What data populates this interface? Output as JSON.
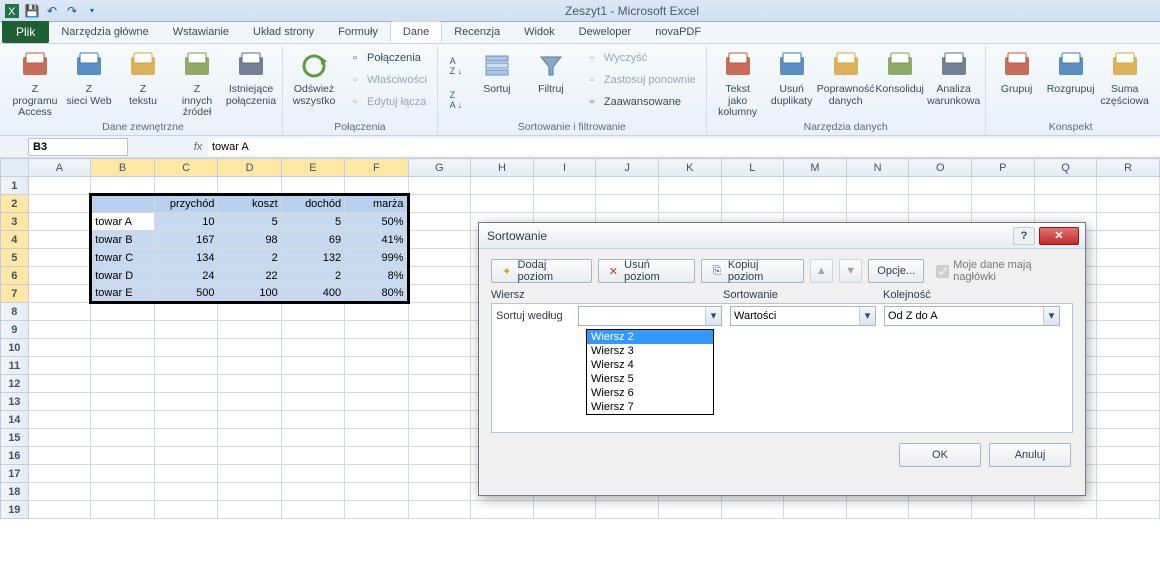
{
  "window_title": "Zeszyt1 - Microsoft Excel",
  "tabs": {
    "file": "Plik",
    "items": [
      "Narzędzia główne",
      "Wstawianie",
      "Układ strony",
      "Formuły",
      "Dane",
      "Recenzja",
      "Widok",
      "Deweloper",
      "novaPDF"
    ],
    "active": "Dane"
  },
  "ribbon": {
    "groups": {
      "external": {
        "label": "Dane zewnętrzne",
        "buttons": [
          "Z programu Access",
          "Z sieci Web",
          "Z tekstu",
          "Z innych źródeł",
          "Istniejące połączenia"
        ]
      },
      "connections": {
        "label": "Połączenia",
        "refresh": "Odśwież wszystko",
        "items": [
          "Połączenia",
          "Właściwości",
          "Edytuj łącza"
        ]
      },
      "sort": {
        "label": "Sortowanie i filtrowanie",
        "sort": "Sortuj",
        "filter": "Filtruj",
        "items": [
          "Wyczyść",
          "Zastosuj ponownie",
          "Zaawansowane"
        ]
      },
      "datatools": {
        "label": "Narzędzia danych",
        "buttons": [
          "Tekst jako kolumny",
          "Usuń duplikaty",
          "Poprawność danych",
          "Konsoliduj",
          "Analiza warunkowa"
        ]
      },
      "outline": {
        "label": "Konspekt",
        "buttons": [
          "Grupuj",
          "Rozgrupuj",
          "Suma częściowa"
        ]
      }
    }
  },
  "namebox": "B3",
  "formula": "towar A",
  "sheet": {
    "cols": [
      "A",
      "B",
      "C",
      "D",
      "E",
      "F",
      "G",
      "H",
      "I",
      "J",
      "K",
      "L",
      "M",
      "N",
      "O",
      "P",
      "Q",
      "R"
    ],
    "selected_cols": [
      "B",
      "C",
      "D",
      "E",
      "F"
    ],
    "selected_rows": [
      2,
      3,
      4,
      5,
      6,
      7
    ],
    "row_count": 19,
    "headers": {
      "C": "przychód",
      "D": "koszt",
      "E": "dochód",
      "F": "marża"
    },
    "rows": [
      {
        "B": "towar A",
        "C": "10",
        "D": "5",
        "E": "5",
        "F": "50%"
      },
      {
        "B": "towar B",
        "C": "167",
        "D": "98",
        "E": "69",
        "F": "41%"
      },
      {
        "B": "towar C",
        "C": "134",
        "D": "2",
        "E": "132",
        "F": "99%"
      },
      {
        "B": "towar D",
        "C": "24",
        "D": "22",
        "E": "2",
        "F": "8%"
      },
      {
        "B": "towar E",
        "C": "500",
        "D": "100",
        "E": "400",
        "F": "80%"
      }
    ]
  },
  "dialog": {
    "title": "Sortowanie",
    "toolbar": {
      "add": "Dodaj poziom",
      "delete": "Usuń poziom",
      "copy": "Kopiuj poziom",
      "options": "Opcje...",
      "headers_cb": "Moje dane mają nagłówki"
    },
    "col_labels": {
      "col": "Wiersz",
      "sorton": "Sortowanie",
      "order": "Kolejność"
    },
    "row": {
      "label": "Sortuj według",
      "col_value": "",
      "sorton_value": "Wartości",
      "order_value": "Od Z do A"
    },
    "dropdown": [
      "Wiersz 2",
      "Wiersz 3",
      "Wiersz 4",
      "Wiersz 5",
      "Wiersz 6",
      "Wiersz 7"
    ],
    "ok": "OK",
    "cancel": "Anuluj"
  }
}
